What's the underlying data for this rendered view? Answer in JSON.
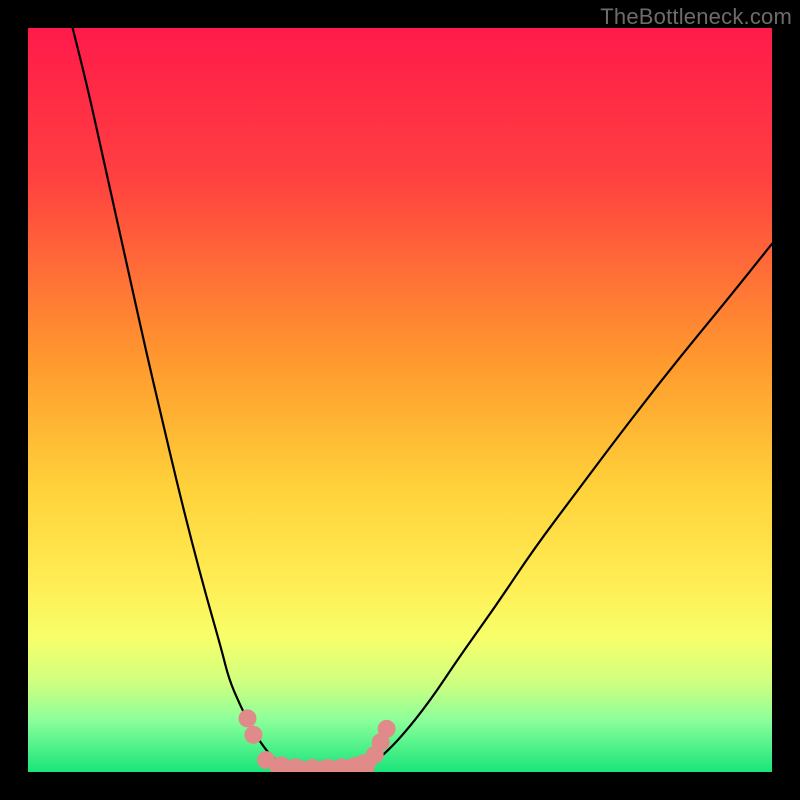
{
  "watermark": "TheBottleneck.com",
  "chart_data": {
    "type": "line",
    "title": "",
    "xlabel": "",
    "ylabel": "",
    "xlim": [
      0,
      100
    ],
    "ylim": [
      0,
      100
    ],
    "gradient_stops": [
      {
        "offset": 0,
        "color": "#ff1a4b"
      },
      {
        "offset": 20,
        "color": "#ff4040"
      },
      {
        "offset": 45,
        "color": "#ff9a2e"
      },
      {
        "offset": 62,
        "color": "#ffd23a"
      },
      {
        "offset": 75,
        "color": "#ffee55"
      },
      {
        "offset": 82,
        "color": "#f7ff6a"
      },
      {
        "offset": 88,
        "color": "#cfff80"
      },
      {
        "offset": 93,
        "color": "#8cff9a"
      },
      {
        "offset": 100,
        "color": "#18e57a"
      }
    ],
    "series": [
      {
        "name": "left-branch",
        "x": [
          6,
          8,
          10,
          12,
          14,
          16,
          18,
          20,
          22,
          24,
          26,
          27,
          28.5,
          30,
          31.5,
          33,
          35
        ],
        "y": [
          100,
          92,
          83,
          74,
          65,
          56,
          47.5,
          39,
          31,
          23.5,
          16.5,
          12.5,
          9,
          6,
          3.6,
          1.8,
          0.4
        ]
      },
      {
        "name": "floor",
        "x": [
          35,
          37,
          39,
          41,
          43,
          45
        ],
        "y": [
          0.4,
          0.15,
          0.1,
          0.1,
          0.15,
          0.3
        ]
      },
      {
        "name": "right-branch",
        "x": [
          45,
          47,
          50,
          54,
          58,
          63,
          68,
          74,
          80,
          87,
          94,
          100
        ],
        "y": [
          0.3,
          1.6,
          4.5,
          9.5,
          15.5,
          22.5,
          30,
          38,
          46,
          55,
          63.5,
          71
        ]
      }
    ],
    "markers": {
      "name": "cluster",
      "color": "#e08a8a",
      "points": [
        {
          "x": 29.5,
          "y": 7.2
        },
        {
          "x": 30.3,
          "y": 5.0
        },
        {
          "x": 32.0,
          "y": 1.6
        },
        {
          "x": 34.0,
          "y": 0.6
        },
        {
          "x": 36.0,
          "y": 0.35
        },
        {
          "x": 38.2,
          "y": 0.28
        },
        {
          "x": 40.3,
          "y": 0.28
        },
        {
          "x": 42.2,
          "y": 0.35
        },
        {
          "x": 44.0,
          "y": 0.55
        },
        {
          "x": 45.2,
          "y": 0.9
        },
        {
          "x": 46.6,
          "y": 2.3
        },
        {
          "x": 47.4,
          "y": 4.0
        },
        {
          "x": 48.2,
          "y": 5.8
        }
      ]
    }
  }
}
